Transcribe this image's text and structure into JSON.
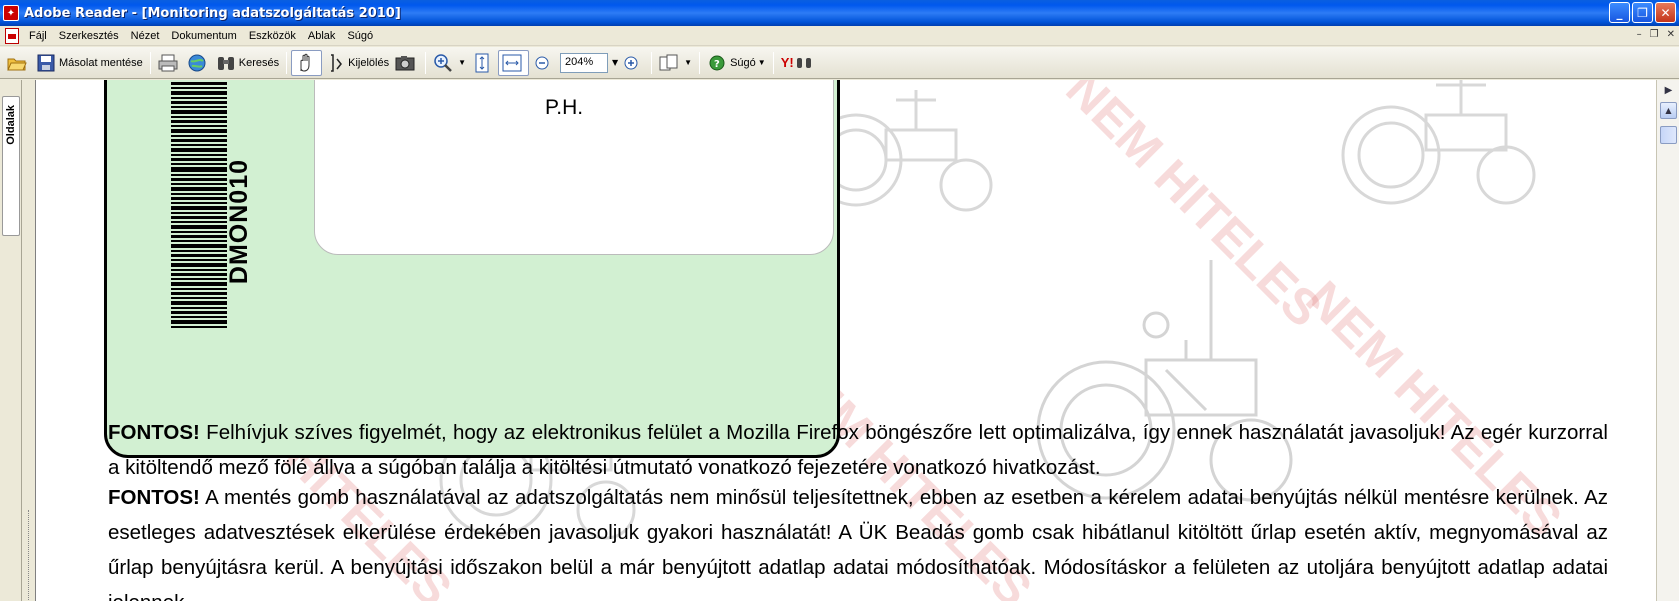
{
  "window": {
    "title": "Adobe Reader - [Monitoring adatszolgáltatás 2010]",
    "buttons": {
      "minimize": "_",
      "restore": "❐",
      "close": "✕"
    }
  },
  "menu": {
    "items": [
      "Fájl",
      "Szerkesztés",
      "Nézet",
      "Dokumentum",
      "Eszközök",
      "Ablak",
      "Súgó"
    ],
    "doc_controls": {
      "minimize": "–",
      "restore": "❐",
      "close": "✕"
    }
  },
  "toolbar": {
    "save_copy_label": "Másolat mentése",
    "search_label": "Keresés",
    "select_label": "Kijelölés",
    "zoom_value": "204%",
    "help_label": "Súgó",
    "yahoo_label": "Y!"
  },
  "leftpane": {
    "pages_tab_label": "Oldalak"
  },
  "document": {
    "stamp_label": "P.H.",
    "barcode_text": "DMON010",
    "watermark_text": "NEM HITELES",
    "paragraph1_bold": "FONTOS!",
    "paragraph1_text": " Felhívjuk szíves figyelmét, hogy az elektronikus felület a Mozilla Firefox böngészőre lett optimalizálva, így ennek használatát javasoljuk! Az egér kurzorral a kitöltendő mező fölé állva a súgóban találja a kitöltési útmutató vonatkozó fejezetére vonatkozó hivatkozást.",
    "paragraph2_bold": "FONTOS!",
    "paragraph2_text": " A mentés gomb használatával az adatszolgáltatás nem minősül teljesítettnek, ebben az esetben a kérelem adatai benyújtás nélkül mentésre kerülnek. Az esetleges adatvesztések elkerülése érdekében javasoljuk gyakori használatát! A ÜK Beadás gomb csak hibátlanul kitöltött űrlap esetén aktív, megnyomásával az űrlap benyújtásra kerül. A benyújtási időszakon belül a már benyújtott adatlap adatai módosíthatóak. Módosításkor a felületen az utoljára benyújtott adatlap adatai jelennek"
  },
  "colors": {
    "stamp_bg": "#d2f0d2",
    "title_bar": "#0058ee",
    "watermark": "#dc5a5a"
  }
}
